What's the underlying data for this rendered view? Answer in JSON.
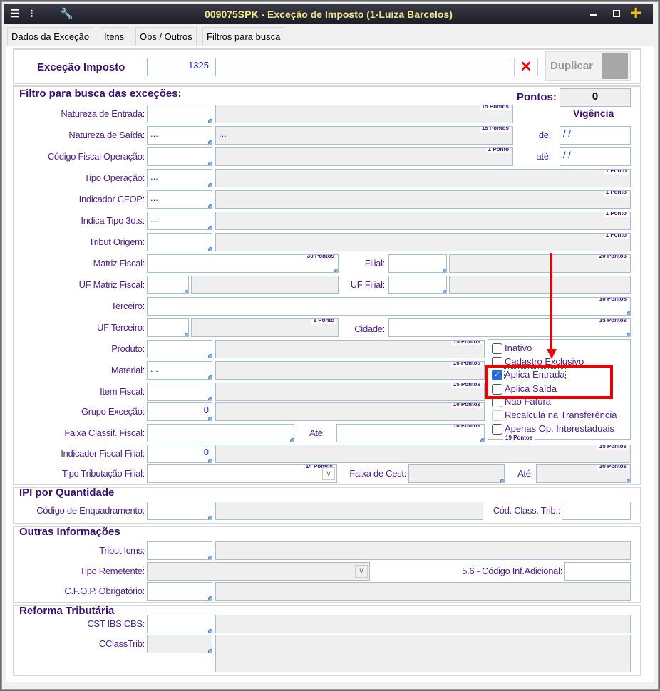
{
  "window": {
    "title": "009075SPK - Exceção de Imposto (1-Luiza Barcelos)",
    "icons": [
      "menu-icon",
      "traffic-light-icon",
      "wrench-icon"
    ],
    "controls": [
      "minimize",
      "maximize",
      "plus"
    ]
  },
  "tabs": [
    {
      "label": "Dados da Exceção",
      "active": true
    },
    {
      "label": "Itens"
    },
    {
      "label": "Obs / Outros"
    },
    {
      "label": "Filtros para busca"
    }
  ],
  "header": {
    "label": "Exceção Imposto",
    "code": "1325",
    "description": "",
    "clear_icon": "close-x-icon",
    "duplicate_label": "Duplicar"
  },
  "filter": {
    "title": "Filtro para busca das exceções:",
    "pontos_label": "Pontos:",
    "pontos_value": "0",
    "vigencia_label": "Vigência",
    "de_label": "de:",
    "de_value": " / /",
    "ate_label": "até:",
    "ate_value": " / /",
    "fields": {
      "natEntrada": {
        "label": "Natureza de Entrada:",
        "code": "",
        "desc": "",
        "points": "15 Pontos"
      },
      "natSaida": {
        "label": "Natureza de Saída:",
        "code": "...",
        "desc": "...",
        "points": "15 Pontos"
      },
      "cfo": {
        "label": "Código Fiscal Operação:",
        "code": "",
        "desc": "",
        "points": "1 Ponto"
      },
      "tipoOp": {
        "label": "Tipo Operação:",
        "code": "...",
        "desc": "",
        "points": "1 Ponto"
      },
      "indCfop": {
        "label": "Indicador CFOP:",
        "code": "...",
        "desc": "",
        "points": "1 Ponto"
      },
      "indTipo": {
        "label": "Indica Tipo 3o.s:",
        "code": "...",
        "desc": "",
        "points": "1 Ponto"
      },
      "tribOrig": {
        "label": "Tribut Origem:",
        "code": "",
        "desc": "",
        "points": "1 Ponto"
      },
      "matriz": {
        "label": "Matriz Fiscal:",
        "code": "",
        "points": "30 Pontos"
      },
      "filial": {
        "label": "Filial:",
        "code": "",
        "desc": "",
        "points": "20 Pontos"
      },
      "ufMatriz": {
        "label": "UF Matriz Fiscal:",
        "code": "",
        "desc": ""
      },
      "ufFilial": {
        "label": "UF Filial:",
        "code": "",
        "desc": ""
      },
      "terceiro": {
        "label": "Terceiro:",
        "code": "",
        "points": "10 Pontos"
      },
      "ufTerceiro": {
        "label": "UF Terceiro:",
        "code": "",
        "desc": "",
        "points": "1 Ponto"
      },
      "cidade": {
        "label": "Cidade:",
        "code": "",
        "points": "15 Pontos"
      },
      "produto": {
        "label": "Produto:",
        "code": "",
        "desc": "",
        "points": "15 Pontos"
      },
      "material": {
        "label": "Material:",
        "code": " .  .",
        "desc": "",
        "points": "15 Pontos"
      },
      "itemFiscal": {
        "label": "Item Fiscal:",
        "code": "",
        "desc": "",
        "points": "15 Pontos"
      },
      "grupo": {
        "label": "Grupo Exceção:",
        "code": "0",
        "desc": "",
        "points": "10 Pontos"
      },
      "faixaClass": {
        "label": "Faixa Classif. Fiscal:",
        "code": ""
      },
      "faixaClassAte": {
        "label": "Até:",
        "code": "",
        "points": "10 Pontos"
      },
      "indFiscFilial": {
        "label": "Indicador Fiscal Filial:",
        "code": "0",
        "desc": "",
        "points": "15 Pontos"
      },
      "tipoTribFilial": {
        "label": "Tipo Tributação Filial:",
        "code": "",
        "points": "14 Pontos"
      },
      "faixaCest": {
        "label": "Faixa de Cest:",
        "code": ""
      },
      "faixaCestAte": {
        "label": "Até:",
        "code": "",
        "points": "10 Pontos"
      }
    },
    "options_points": "19 Pontos",
    "options": [
      {
        "label": "Inativo",
        "checked": false
      },
      {
        "label": "Cadastro Exclusivo",
        "checked": false
      },
      {
        "label": "Aplica Entrada",
        "checked": true
      },
      {
        "label": "Aplica Saída",
        "checked": false
      },
      {
        "label": "Não Fatura",
        "checked": false
      },
      {
        "label": "Recalcula na Transferência",
        "checked": false,
        "disabled": true
      },
      {
        "label": "Apenas Op. Interestaduais",
        "checked": false
      }
    ],
    "highlight_color": "#ee0000"
  },
  "ipi": {
    "title": "IPI por Quantidade",
    "fields": {
      "enq": {
        "label": "Código de Enquadramento:",
        "code": "",
        "desc": ""
      },
      "classTrib": {
        "label": "Cód. Class. Trib.:",
        "code": ""
      }
    }
  },
  "outras": {
    "title": "Outras Informações",
    "fields": {
      "tribIcms": {
        "label": "Tribut Icms:",
        "code": "",
        "desc": ""
      },
      "tipoRem": {
        "label": "Tipo Remetente:",
        "code": ""
      },
      "infAd": {
        "label": "5.6 - Código Inf.Adicional:",
        "code": ""
      },
      "cfopObr": {
        "label": "C.F.O.P. Obrigatório:",
        "code": "",
        "desc": ""
      }
    }
  },
  "reforma": {
    "title": "Reforma Tributária",
    "fields": {
      "cst": {
        "label": "CST IBS CBS:",
        "code": "",
        "desc": ""
      },
      "cclass": {
        "label": "CClassTrib:",
        "code": "",
        "desc": ""
      }
    }
  }
}
